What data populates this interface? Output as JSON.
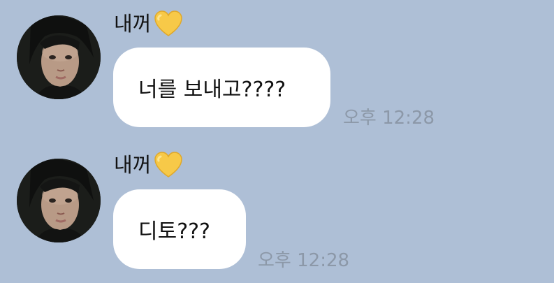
{
  "messages": [
    {
      "sender": "내꺼",
      "sender_icon": "yellow-heart-icon",
      "text": "너를 보내고????",
      "time": "오후 12:28"
    },
    {
      "sender": "내꺼",
      "sender_icon": "yellow-heart-icon",
      "text": "디토???",
      "time": "오후 12:28"
    }
  ],
  "colors": {
    "background": "#aebfd6",
    "bubble": "#ffffff",
    "heart": "#f7c948",
    "timestamp": "#8c98a8"
  }
}
